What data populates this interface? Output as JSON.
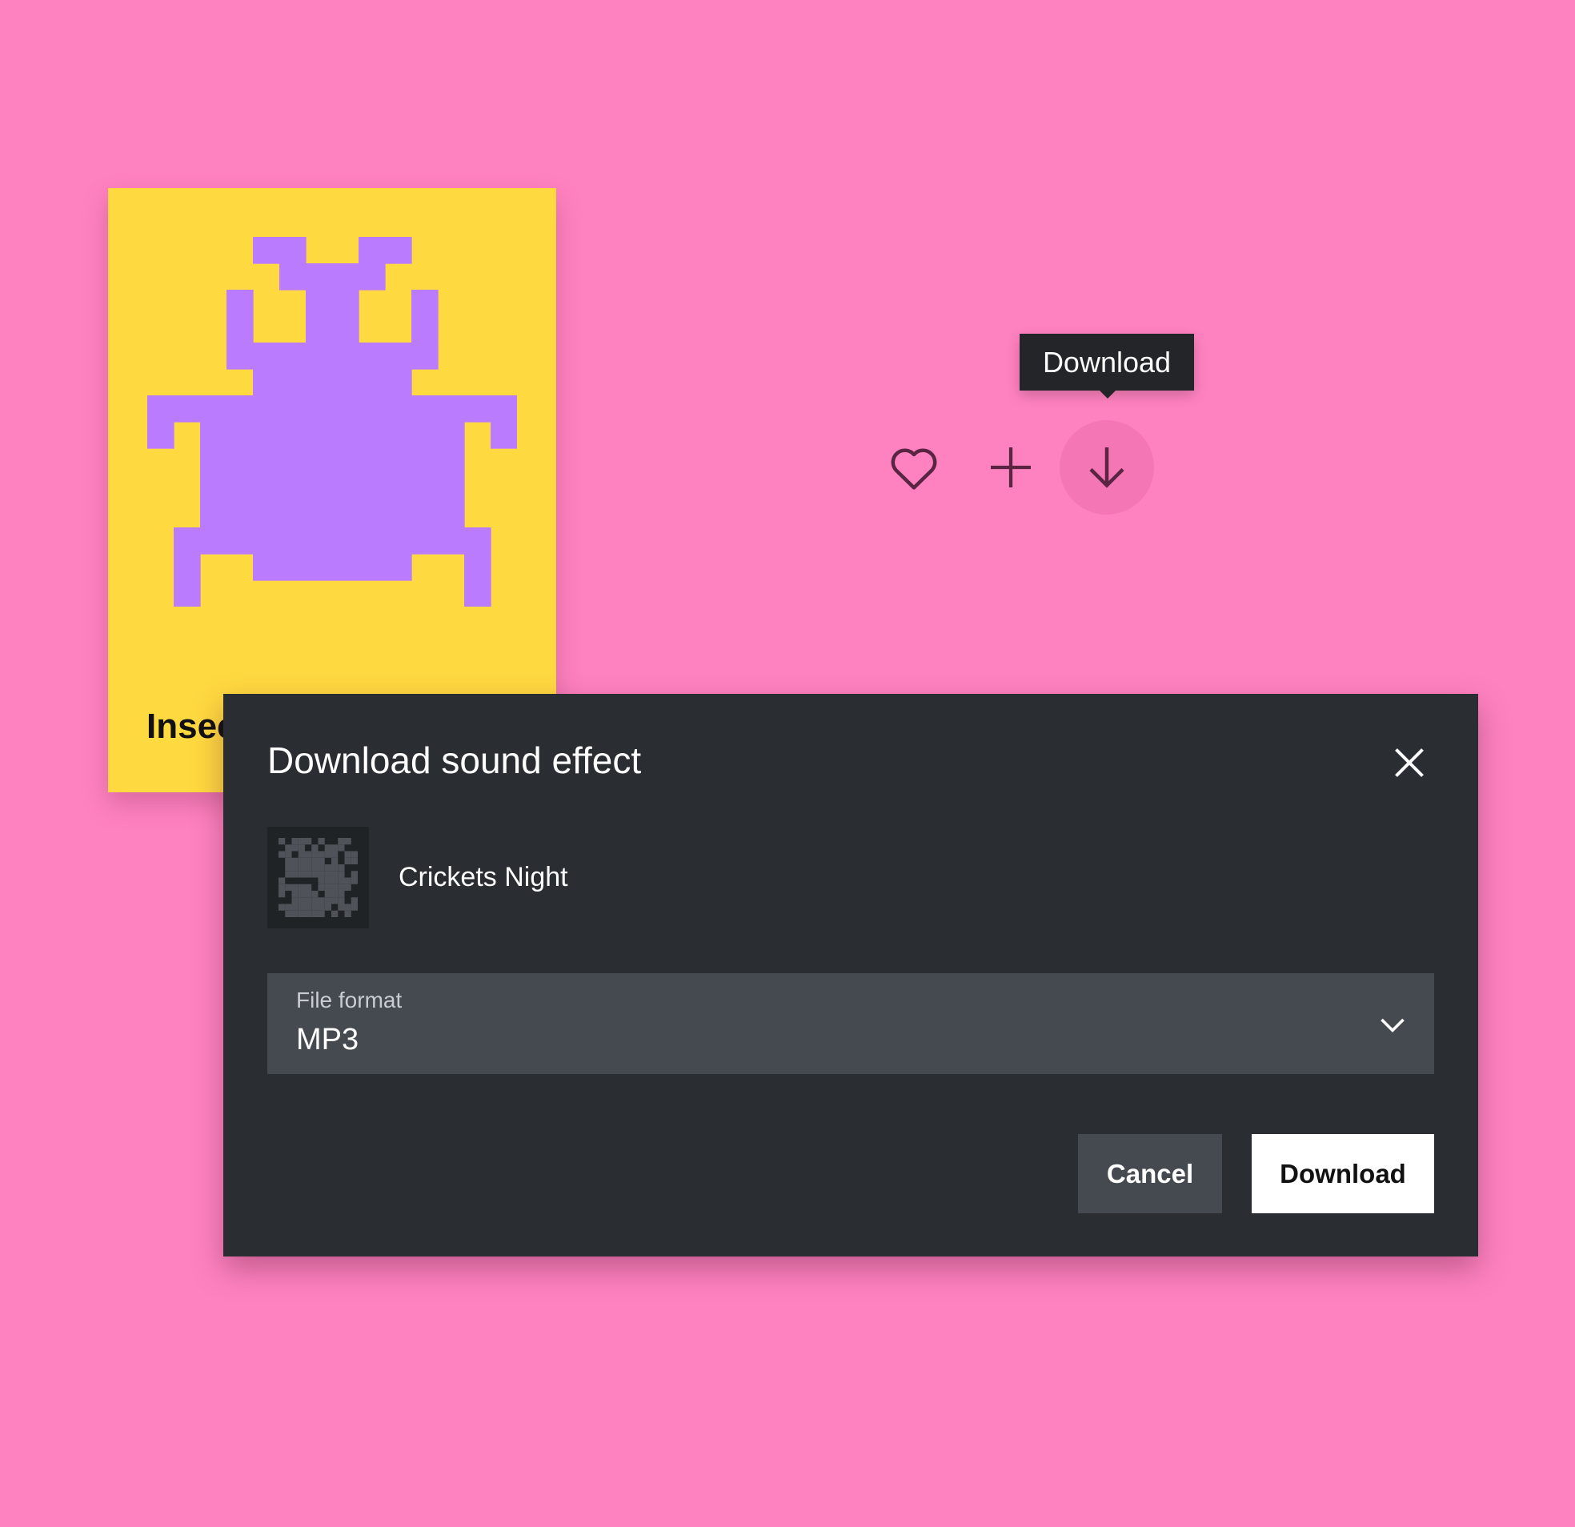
{
  "colors": {
    "background": "#FF82C0",
    "card": "#FFD940",
    "bug": "#BB7BFF",
    "dialog": "#2A2D31",
    "field": "#454950",
    "icon": "#5A2443"
  },
  "card": {
    "title": "Insects",
    "icon": "pixel-bug-icon"
  },
  "actions": {
    "tooltip": "Download",
    "icons": [
      "heart-icon",
      "plus-icon",
      "download-arrow-icon"
    ]
  },
  "dialog": {
    "title": "Download sound effect",
    "sound_name": "Crickets Night",
    "file_format": {
      "label": "File format",
      "value": "MP3"
    },
    "cancel_label": "Cancel",
    "download_label": "Download"
  }
}
